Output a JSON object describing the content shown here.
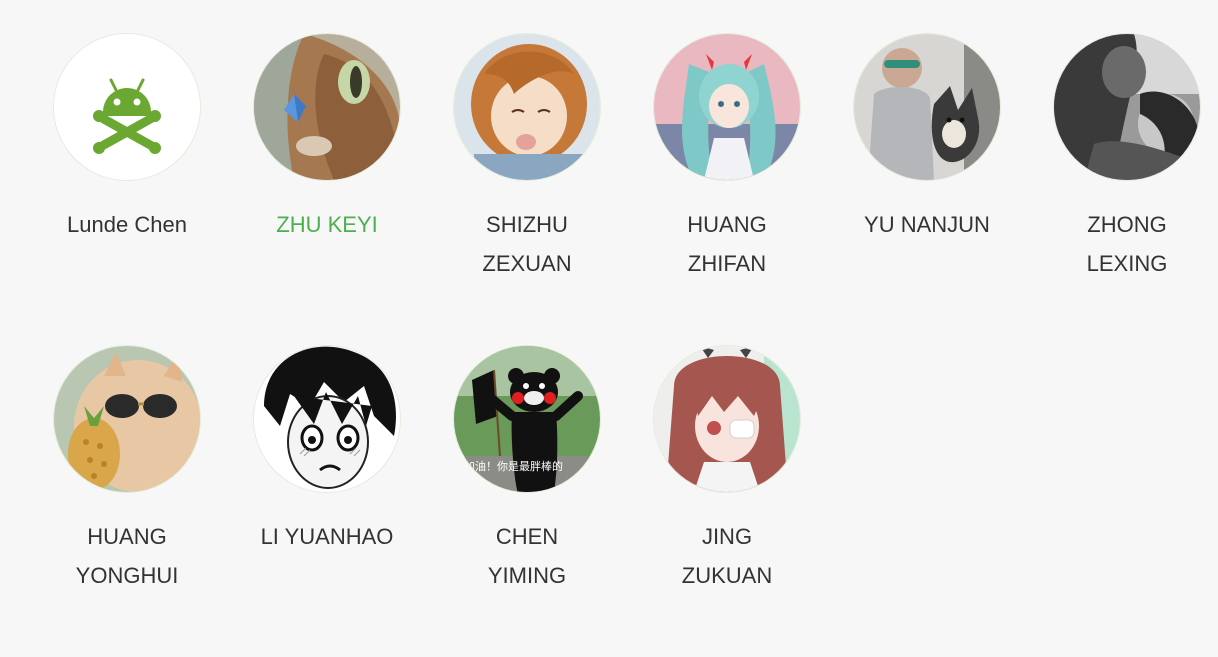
{
  "accent_color": "#4caf50",
  "text_color": "#333333",
  "members": [
    {
      "name": "Lunde Chen",
      "avatar_icon": "android-skull-icon",
      "highlight": false
    },
    {
      "name": "ZHU KEYI",
      "avatar_icon": "cat-butterfly-avatar",
      "highlight": true
    },
    {
      "name": "SHIZHU ZEXUAN",
      "avatar_icon": "anime-girl-avatar",
      "highlight": false
    },
    {
      "name": "HUANG ZHIFAN",
      "avatar_icon": "anime-twintail-avatar",
      "highlight": false
    },
    {
      "name": "YU NANJUN",
      "avatar_icon": "boy-with-dog-avatar",
      "highlight": false
    },
    {
      "name": "ZHONG LEXING",
      "avatar_icon": "couple-photo-avatar",
      "highlight": false
    },
    {
      "name": "HUANG YONGHUI",
      "avatar_icon": "cat-sunglasses-avatar",
      "highlight": false
    },
    {
      "name": "LI YUANHAO",
      "avatar_icon": "manga-boy-avatar",
      "highlight": false
    },
    {
      "name": "CHEN YIMING",
      "avatar_icon": "kumamon-avatar",
      "highlight": false,
      "avatar_caption": "加油！你是最胖棒的"
    },
    {
      "name": "JING ZUKUAN",
      "avatar_icon": "anime-eyepatch-girl-avatar",
      "highlight": false
    }
  ]
}
